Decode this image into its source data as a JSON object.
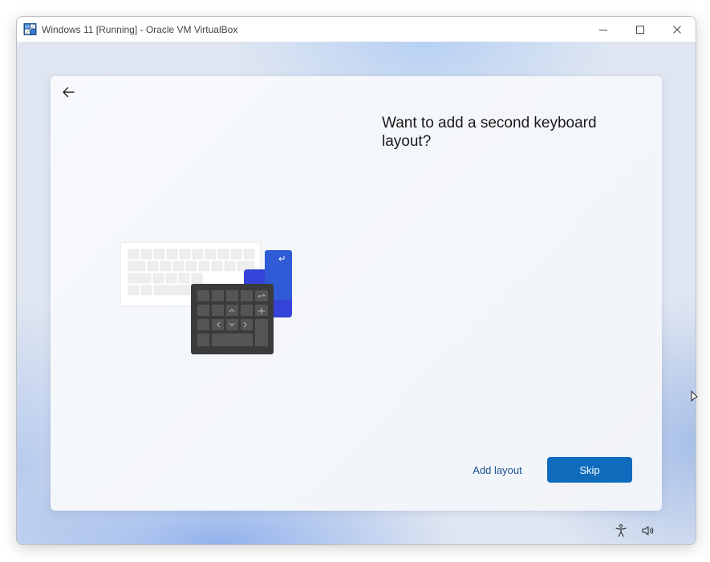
{
  "window": {
    "title": "Windows 11 [Running] - Oracle VM VirtualBox",
    "controls": [
      "minimize-icon",
      "maximize-icon",
      "close-icon"
    ]
  },
  "oobe": {
    "back_icon": "back-arrow-icon",
    "heading": "Want to add a second keyboard layout?",
    "add_layout_label": "Add layout",
    "skip_label": "Skip",
    "accent_color": "#0f6cbd"
  },
  "tray": {
    "icons": [
      "accessibility-icon",
      "volume-icon"
    ]
  }
}
